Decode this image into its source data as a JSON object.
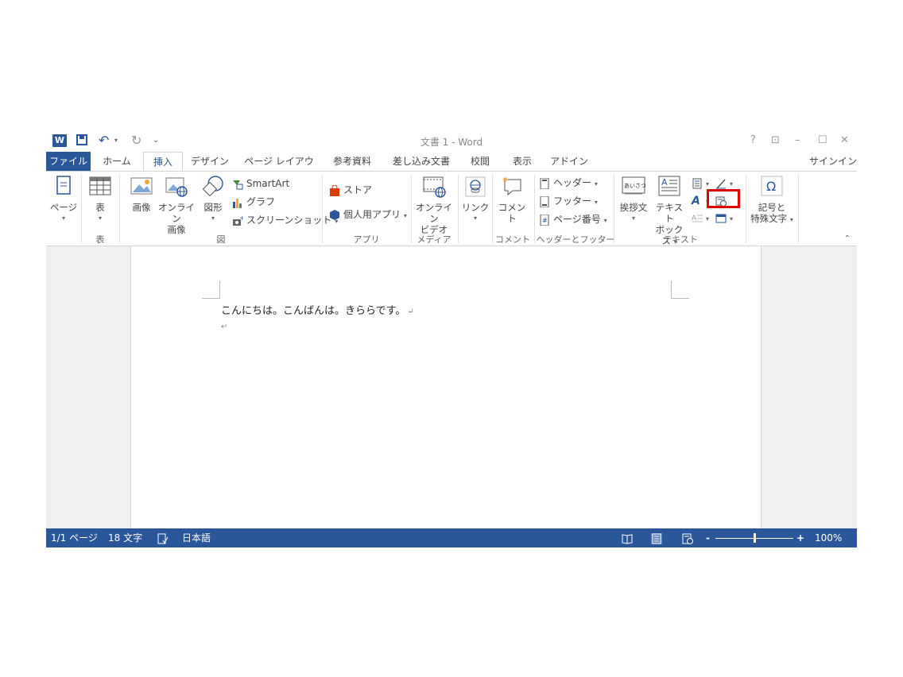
{
  "window": {
    "title": "文書 1 - Word",
    "help": "?",
    "ribbon_opts": "⊡",
    "minimize": "–",
    "maximize": "☐",
    "close": "✕",
    "qat_dropdown": "⌄"
  },
  "tabs": {
    "file": "ファイル",
    "home": "ホーム",
    "insert": "挿入",
    "design": "デザイン",
    "page_layout": "ページ レイアウト",
    "references": "参考資料",
    "mailings": "差し込み文書",
    "review": "校閲",
    "view": "表示",
    "addins": "アドイン",
    "signin": "サインイン"
  },
  "ribbon": {
    "pages": "ページ",
    "table": "表",
    "picture": "画像",
    "online_picture_1": "オンライン",
    "online_picture_2": "画像",
    "shapes": "図形",
    "smartart": "SmartArt",
    "chart": "グラフ",
    "screenshot": "スクリーンショット",
    "store": "ストア",
    "my_apps": "個人用アプリ",
    "online_video_1": "オンライン",
    "online_video_2": "ビデオ",
    "link": "リンク",
    "comment": "コメント",
    "header": "ヘッダー",
    "footer": "フッター",
    "page_number": "ページ番号",
    "greeting": "挨拶文",
    "textbox_1": "テキスト",
    "textbox_2": "ボックス",
    "symbol_1": "記号と",
    "symbol_2": "特殊文字",
    "greeting_icon_text": "あいさつ",
    "groups": {
      "table": "表",
      "illustrations": "図",
      "apps": "アプリ",
      "media": "メディア",
      "comments": "コメント",
      "header_footer": "ヘッダーとフッター",
      "text": "テキスト"
    }
  },
  "document": {
    "line1": "こんにちは。こんばんは。きららです。",
    "para_mark": "↵"
  },
  "status": {
    "page": "1/1 ページ",
    "words": "18 文字",
    "language": "日本語",
    "zoom": "100%",
    "zoom_minus": "-",
    "zoom_plus": "+"
  },
  "colors": {
    "accent": "#2b579a",
    "highlight_box": "#e00000"
  }
}
